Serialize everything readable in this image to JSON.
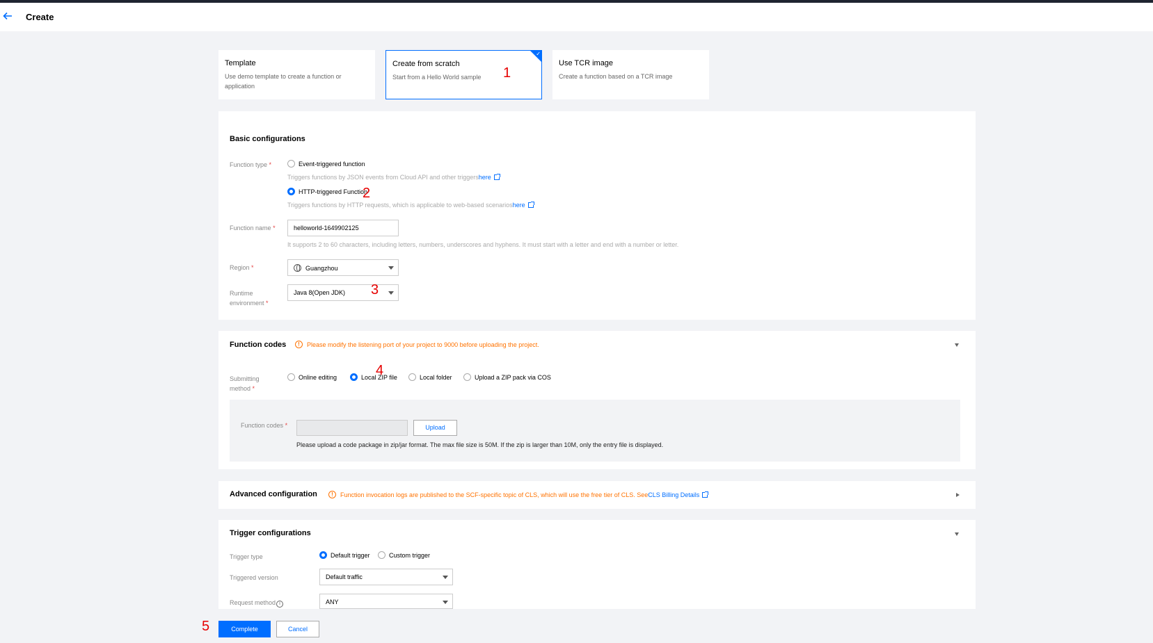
{
  "header": {
    "title": "Create"
  },
  "mode_cards": [
    {
      "title": "Template",
      "desc": "Use demo template to create a function or application",
      "selected": false
    },
    {
      "title": "Create from scratch",
      "desc": "Start from a Hello World sample",
      "selected": true
    },
    {
      "title": "Use TCR image",
      "desc": "Create a function based on a TCR image",
      "selected": false
    }
  ],
  "annotations": [
    "1",
    "2",
    "3",
    "4",
    "5"
  ],
  "basic": {
    "title": "Basic configurations",
    "function_type_label": "Function type",
    "event_option": "Event-triggered function",
    "event_hint": "Triggers functions by JSON events from Cloud API and other triggers",
    "event_hint_link": "here",
    "http_option": "HTTP-triggered Function",
    "http_hint": "Triggers functions by HTTP requests, which is applicable to web-based scenarios",
    "http_hint_link": "here",
    "function_type_selected": "HTTP-triggered Function",
    "name_label": "Function name",
    "name_value": "helloworld-1649902125",
    "name_hint": "It supports 2 to 60 characters, including letters, numbers, underscores and hyphens. It must start with a letter and end with a number or letter.",
    "region_label": "Region",
    "region_value": "Guangzhou",
    "runtime_label_1": "Runtime",
    "runtime_label_2": "environment",
    "runtime_value": "Java 8(Open JDK)"
  },
  "codes": {
    "title": "Function codes",
    "warning": "Please modify the listening port of your project to 9000 before uploading the project.",
    "method_label_1": "Submitting",
    "method_label_2": "method",
    "methods": [
      "Online editing",
      "Local ZIP file",
      "Local folder",
      "Upload a ZIP pack via COS"
    ],
    "method_selected": "Local ZIP file",
    "codes_label": "Function codes",
    "upload_button": "Upload",
    "upload_hint": "Please upload a code package in zip/jar format. The max file size is 50M. If the zip is larger than 10M, only the entry file is displayed."
  },
  "advanced": {
    "title": "Advanced configuration",
    "warning": "Function invocation logs are published to the SCF-specific topic of CLS, which will use the free tier of CLS. See ",
    "warning_link": "CLS Billing Details"
  },
  "trigger": {
    "title": "Trigger configurations",
    "type_label": "Trigger type",
    "types": [
      "Default trigger",
      "Custom trigger"
    ],
    "type_selected": "Default trigger",
    "version_label": "Triggered version",
    "version_value": "Default traffic",
    "method_label": "Request method",
    "method_value": "ANY"
  },
  "footer": {
    "complete": "Complete",
    "cancel": "Cancel"
  },
  "colors": {
    "primary": "#006eff",
    "warning": "#ff7200",
    "annotation": "#e60000"
  }
}
